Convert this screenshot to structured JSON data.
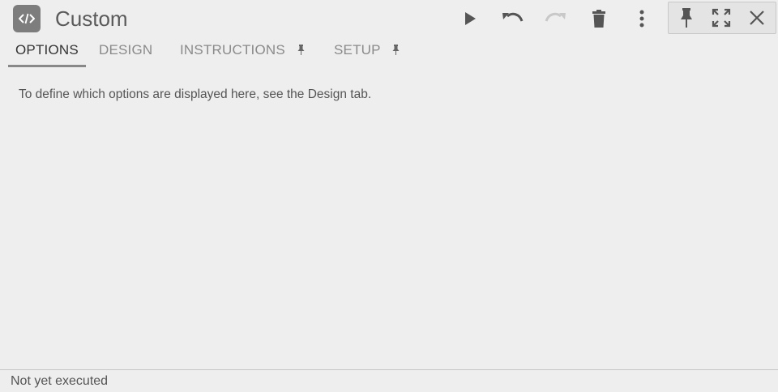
{
  "header": {
    "title": "Custom",
    "app_icon": "code-icon",
    "toolbar": [
      {
        "name": "run-button",
        "icon": "play-icon",
        "enabled": true
      },
      {
        "name": "undo-button",
        "icon": "undo-icon",
        "enabled": true
      },
      {
        "name": "redo-button",
        "icon": "redo-icon",
        "enabled": false
      },
      {
        "name": "delete-button",
        "icon": "trash-icon",
        "enabled": true
      },
      {
        "name": "more-button",
        "icon": "more-vertical-icon",
        "enabled": true
      }
    ],
    "window_controls": [
      {
        "name": "pin-button",
        "icon": "pin-icon"
      },
      {
        "name": "maximize-button",
        "icon": "expand-icon"
      },
      {
        "name": "close-button",
        "icon": "close-icon"
      }
    ]
  },
  "tabs": [
    {
      "label": "OPTIONS",
      "active": true,
      "pinned": false
    },
    {
      "label": "DESIGN",
      "active": false,
      "pinned": false
    },
    {
      "label": "INSTRUCTIONS",
      "active": false,
      "pinned": true
    },
    {
      "label": "SETUP",
      "active": false,
      "pinned": true
    }
  ],
  "main": {
    "hint": "To define which options are displayed here, see the Design tab."
  },
  "status": {
    "text": "Not yet executed"
  },
  "colors": {
    "background": "#eeeeee",
    "icon_dark": "#6a6a6a",
    "icon_disabled": "#c4c4c4",
    "app_icon_bg": "#7d7d7d"
  }
}
